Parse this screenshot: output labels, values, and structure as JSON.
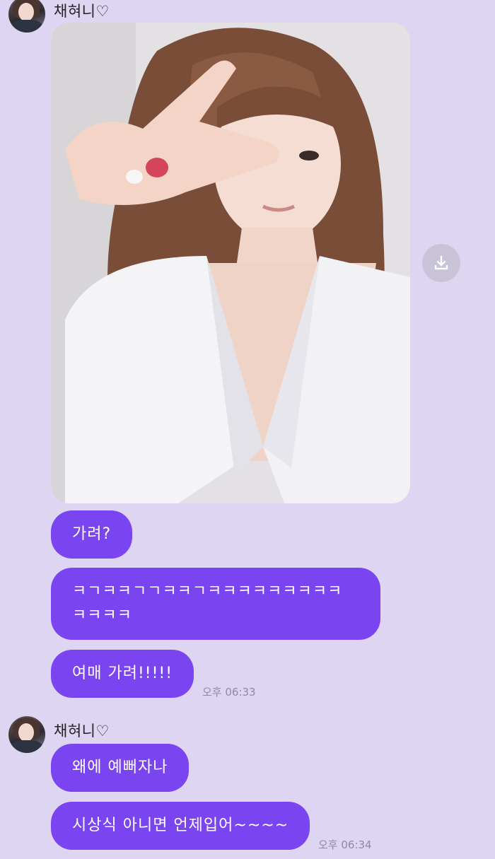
{
  "thread": {
    "sender_name": "채혀니♡"
  },
  "messages": [
    {
      "text": "가려?"
    },
    {
      "text": "ㅋㄱㅋㅋㄱㄱㅋㅋㄱㅋㅋㅋㅋㅋㅋㅋㅋㅋ\nㅋㅋㅋㅋ"
    },
    {
      "text": "여매 가려!!!!!"
    },
    {
      "text": "왜에 예뻐자나"
    },
    {
      "text": "시상식 아니면 언제입어~~~~"
    }
  ],
  "timestamps": {
    "first_group": "오후 06:33",
    "second_group": "오후 06:34"
  },
  "icons": {
    "download": "download-icon",
    "avatar": "profile-avatar"
  },
  "colors": {
    "background": "#ddd5f2",
    "bubble": "#7a45f0",
    "bubble_text": "#ffffff"
  }
}
